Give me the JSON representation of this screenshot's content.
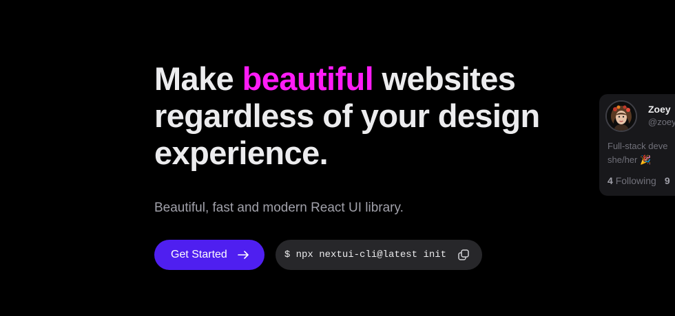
{
  "hero": {
    "headline_part1": "Make ",
    "headline_accent": "beautiful",
    "headline_part2": " websites regardless of your design experience.",
    "subtitle": "Beautiful, fast and modern React UI library.",
    "accent_color": "#ff1cf7"
  },
  "cta": {
    "get_started_label": "Get Started",
    "arrow_icon": "arrow-right-icon",
    "install_command": "$ npx nextui-cli@latest init",
    "copy_icon": "copy-icon",
    "primary_color": "#4f1ff0"
  },
  "profile_card": {
    "name": "Zoey",
    "handle": "@zoey",
    "bio_line1": "Full-stack deve",
    "bio_line2": "she/her 🎉",
    "following_count": "4",
    "following_label": "Following",
    "followers_count_partial": "9",
    "avatar_icon": "avatar-image"
  }
}
